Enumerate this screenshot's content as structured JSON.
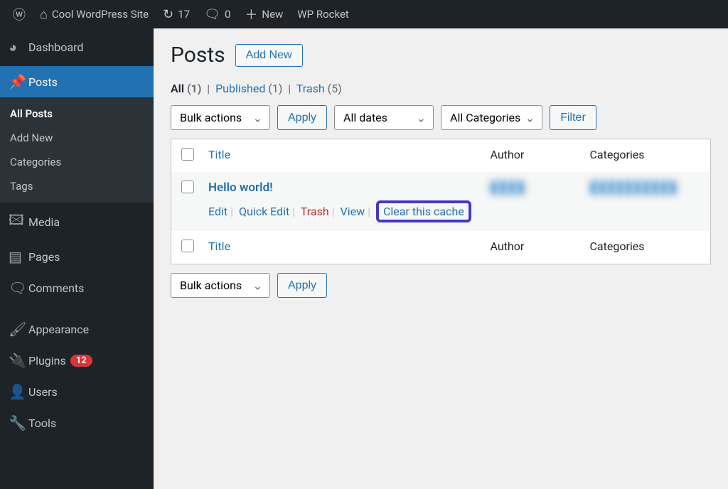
{
  "adminbar": {
    "site_name": "Cool WordPress Site",
    "updates_count": "17",
    "comments_count": "0",
    "new_label": "New",
    "wprocket_label": "WP Rocket"
  },
  "sidebar": {
    "dashboard": "Dashboard",
    "posts": "Posts",
    "posts_sub": {
      "all": "All Posts",
      "add": "Add New",
      "cats": "Categories",
      "tags": "Tags"
    },
    "media": "Media",
    "pages": "Pages",
    "comments": "Comments",
    "appearance": "Appearance",
    "plugins": "Plugins",
    "plugins_badge": "12",
    "users": "Users",
    "tools": "Tools"
  },
  "page": {
    "title": "Posts",
    "add_new": "Add New"
  },
  "views": {
    "all_label": "All",
    "all_count": "(1)",
    "published_label": "Published",
    "published_count": "(1)",
    "trash_label": "Trash",
    "trash_count": "(5)"
  },
  "filters": {
    "bulk": "Bulk actions",
    "apply": "Apply",
    "dates": "All dates",
    "cats": "All Categories",
    "filter": "Filter"
  },
  "table": {
    "col_title": "Title",
    "col_author": "Author",
    "col_cats": "Categories",
    "row": {
      "title": "Hello world!",
      "actions": {
        "edit": "Edit",
        "quick": "Quick Edit",
        "trash": "Trash",
        "view": "View",
        "clear": "Clear this cache"
      },
      "author_blur": "████",
      "cats_blur": "██████████"
    }
  }
}
